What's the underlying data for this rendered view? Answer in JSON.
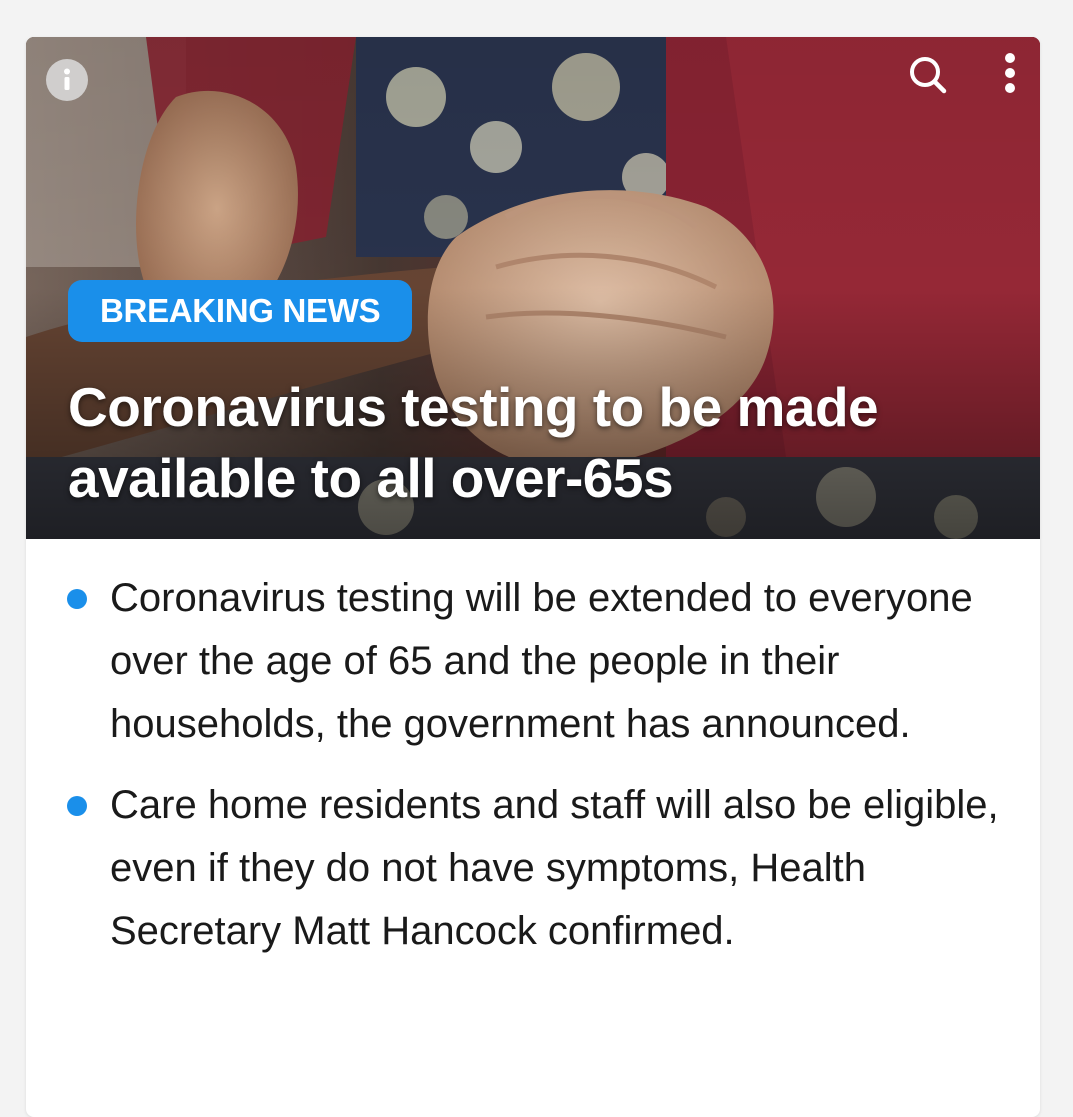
{
  "article": {
    "badge": "BREAKING NEWS",
    "headline": "Coronavirus testing to be made available to all over-65s",
    "bullets": [
      "Coronavirus testing will be extended to everyone over the age of 65 and the people in their households, the government has announced.",
      "Care home residents and staff will also be eligible, even if they do not have symptoms, Health Secretary Matt Hancock confirmed."
    ]
  },
  "icons": {
    "info": "info-icon",
    "search": "search-icon",
    "more": "more-vertical-icon"
  },
  "colors": {
    "accent": "#1a8fea",
    "background": "#f3f3f3",
    "card": "#ffffff",
    "text": "#1a1a1a"
  }
}
